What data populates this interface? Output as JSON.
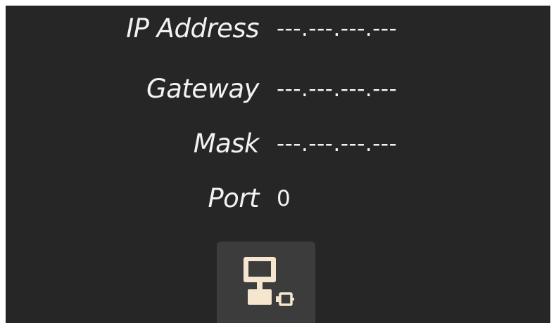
{
  "network": {
    "ip_address": {
      "label": "IP Address",
      "value": "---.---.---.---"
    },
    "gateway": {
      "label": "Gateway",
      "value": "---.---.---.---"
    },
    "mask": {
      "label": "Mask",
      "value": "---.---.---.---"
    },
    "port": {
      "label": "Port",
      "value": "0"
    }
  },
  "actions": {
    "network_button_icon": "network-computer-icon"
  },
  "colors": {
    "background": "#262626",
    "text": "#f2f2f2",
    "button": "#3c3c3c",
    "icon": "#f7e6cf"
  }
}
